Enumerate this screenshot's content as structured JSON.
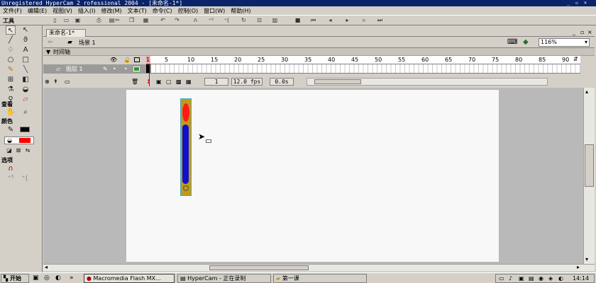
{
  "window": {
    "title": "Unregistered HyperCam 2 rofessional 2004 - [未命名-1*]",
    "controls": [
      "minimize",
      "restore",
      "close"
    ]
  },
  "menu": [
    "文件(F)",
    "编辑(E)",
    "视图(V)",
    "插入(I)",
    "修改(M)",
    "文本(T)",
    "命令(C)",
    "控制(O)",
    "窗口(W)",
    "帮助(H)"
  ],
  "tools_panel": {
    "title": "工具",
    "view_title": "查看",
    "colors_title": "颜色",
    "options_title": "选项"
  },
  "document": {
    "tab_label": "未命名-1*",
    "scene_label": "场景 1",
    "zoom": "116%"
  },
  "timeline": {
    "title": "时间轴",
    "layer_name": "图层 1",
    "frame_numbers": [
      "1",
      "5",
      "10",
      "15",
      "20",
      "25",
      "30",
      "35",
      "40",
      "45",
      "50",
      "55",
      "60",
      "65",
      "70",
      "75",
      "80",
      "85",
      "90"
    ],
    "current_frame": "1",
    "frame_rate": "12.0 fps",
    "elapsed_time": "0.0s"
  },
  "taskbar": {
    "start_label": "开始",
    "tasks": [
      "Macromedia Flash MX...",
      "HyperCam - 正在录制",
      "第一课"
    ],
    "clock": "14:14"
  },
  "colors": {
    "titlebar": "#0a246a",
    "thermometer_frame": "#c09a1a",
    "red_bulb": "#ff1a1a",
    "blue_fill": "#1010c8",
    "stroke_swatch": "#000000",
    "fill_swatch": "#ff0000"
  }
}
